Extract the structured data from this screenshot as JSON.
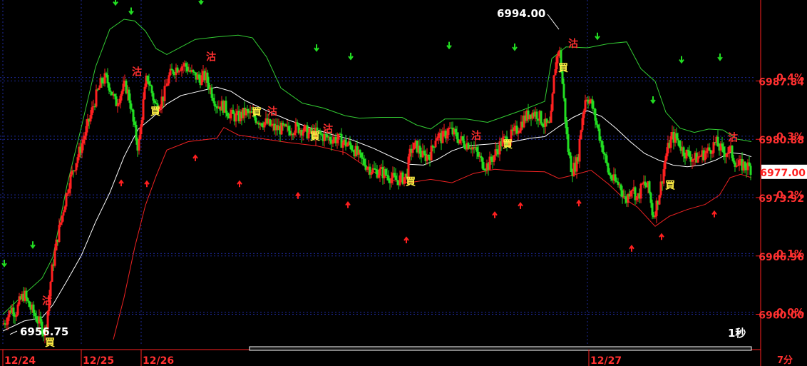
{
  "colors": {
    "background": "#000000",
    "up": "#ff2020",
    "down": "#22dd22",
    "ma": "#ffffff",
    "band_upper": "#33cc33",
    "band_lower": "#ee2222",
    "grid": "#1e2a9a",
    "label_red": "#ff3030",
    "signal": "#ffee44"
  },
  "chart_data": {
    "type": "candlestick",
    "x_ticks": [
      "12/24",
      "12/25",
      "12/26",
      "12/27"
    ],
    "timeframe": "7分",
    "period_label": "1秒",
    "last_price": "6977.00",
    "y_price_labels": [
      "6987.84",
      "6980.88",
      "6973.92",
      "6966.96",
      "6960.00"
    ],
    "y_pct_labels": [
      "0.4%",
      "0.3%",
      "0.2%",
      "0.1%",
      "0.0%"
    ],
    "ylim": [
      6956.3,
      6997.5
    ],
    "annotations": {
      "high": "6994.00",
      "low": "6956.75"
    },
    "signal_labels": {
      "buy": "買",
      "sell": "沽"
    },
    "close_path": [
      [
        0,
        6958.8
      ],
      [
        6,
        6959.6
      ],
      [
        12,
        6960.8
      ],
      [
        18,
        6960.2
      ],
      [
        24,
        6961.6
      ],
      [
        30,
        6962.4
      ],
      [
        36,
        6961.1
      ],
      [
        42,
        6960.3
      ],
      [
        48,
        6959.4
      ],
      [
        54,
        6958.6
      ],
      [
        58,
        6957.6
      ],
      [
        62,
        6959.6
      ],
      [
        68,
        6964.8
      ],
      [
        76,
        6968.9
      ],
      [
        84,
        6972.2
      ],
      [
        92,
        6975.5
      ],
      [
        100,
        6977.6
      ],
      [
        110,
        6980.1
      ],
      [
        120,
        6982.8
      ],
      [
        130,
        6985.8
      ],
      [
        138,
        6987.7
      ],
      [
        144,
        6988.2
      ],
      [
        150,
        6987.2
      ],
      [
        158,
        6985.1
      ],
      [
        166,
        6986.5
      ],
      [
        172,
        6987.3
      ],
      [
        178,
        6985.6
      ],
      [
        184,
        6982.3
      ],
      [
        190,
        6979.7
      ],
      [
        196,
        6984.6
      ],
      [
        202,
        6988.5
      ],
      [
        208,
        6986.8
      ],
      [
        214,
        6984.8
      ],
      [
        220,
        6985.3
      ],
      [
        226,
        6986.1
      ],
      [
        232,
        6988.2
      ],
      [
        240,
        6989.2
      ],
      [
        248,
        6989.7
      ],
      [
        256,
        6989.7
      ],
      [
        266,
        6988.6
      ],
      [
        276,
        6988.1
      ],
      [
        284,
        6988.4
      ],
      [
        292,
        6986.7
      ],
      [
        300,
        6985.0
      ],
      [
        310,
        6984.8
      ],
      [
        320,
        6983.7
      ],
      [
        330,
        6983.5
      ],
      [
        340,
        6984.1
      ],
      [
        350,
        6983.7
      ],
      [
        360,
        6983.1
      ],
      [
        370,
        6982.8
      ],
      [
        380,
        6982.2
      ],
      [
        390,
        6982.1
      ],
      [
        400,
        6981.9
      ],
      [
        410,
        6982.3
      ],
      [
        420,
        6982.1
      ],
      [
        430,
        6981.5
      ],
      [
        440,
        6981.6
      ],
      [
        450,
        6981.2
      ],
      [
        460,
        6981.0
      ],
      [
        470,
        6980.9
      ],
      [
        480,
        6980.4
      ],
      [
        490,
        6980.0
      ],
      [
        500,
        6978.7
      ],
      [
        510,
        6977.8
      ],
      [
        520,
        6977.1
      ],
      [
        530,
        6977.0
      ],
      [
        540,
        6976.6
      ],
      [
        550,
        6976.0
      ],
      [
        560,
        6976.2
      ],
      [
        566,
        6976.5
      ],
      [
        572,
        6979.6
      ],
      [
        580,
        6980.1
      ],
      [
        590,
        6978.7
      ],
      [
        600,
        6979.2
      ],
      [
        608,
        6981.4
      ],
      [
        616,
        6981.0
      ],
      [
        626,
        6982.1
      ],
      [
        636,
        6981.2
      ],
      [
        646,
        6980.5
      ],
      [
        656,
        6980.3
      ],
      [
        664,
        6979.3
      ],
      [
        672,
        6978.1
      ],
      [
        680,
        6977.7
      ],
      [
        690,
        6979.1
      ],
      [
        700,
        6980.6
      ],
      [
        710,
        6981.0
      ],
      [
        720,
        6981.9
      ],
      [
        730,
        6983.2
      ],
      [
        740,
        6984.1
      ],
      [
        750,
        6983.9
      ],
      [
        760,
        6982.6
      ],
      [
        768,
        6982.4
      ],
      [
        774,
        6989.2
      ],
      [
        780,
        6992.1
      ],
      [
        786,
        6986.6
      ],
      [
        792,
        6980.1
      ],
      [
        798,
        6977.1
      ],
      [
        806,
        6978.2
      ],
      [
        812,
        6983.1
      ],
      [
        818,
        6986.2
      ],
      [
        826,
        6985.0
      ],
      [
        834,
        6982.3
      ],
      [
        842,
        6979.6
      ],
      [
        850,
        6976.7
      ],
      [
        858,
        6975.8
      ],
      [
        866,
        6975.4
      ],
      [
        874,
        6973.4
      ],
      [
        882,
        6975.5
      ],
      [
        890,
        6973.7
      ],
      [
        898,
        6975.6
      ],
      [
        906,
        6975.0
      ],
      [
        912,
        6971.6
      ],
      [
        918,
        6973.4
      ],
      [
        924,
        6975.8
      ],
      [
        930,
        6978.9
      ],
      [
        938,
        6981.2
      ],
      [
        946,
        6980.9
      ],
      [
        954,
        6979.5
      ],
      [
        962,
        6979.0
      ],
      [
        970,
        6978.5
      ],
      [
        980,
        6979.0
      ],
      [
        990,
        6979.5
      ],
      [
        1000,
        6980.5
      ],
      [
        1010,
        6979.3
      ],
      [
        1020,
        6979.6
      ],
      [
        1030,
        6977.7
      ],
      [
        1040,
        6977.8
      ],
      [
        1050,
        6977.4
      ]
    ],
    "upper_band": [
      [
        0,
        6960.0
      ],
      [
        30,
        6962.4
      ],
      [
        55,
        6964.3
      ],
      [
        70,
        6966.8
      ],
      [
        90,
        6975.4
      ],
      [
        110,
        6982.3
      ],
      [
        130,
        6989.5
      ],
      [
        150,
        6994.0
      ],
      [
        170,
        6995.2
      ],
      [
        185,
        6995.0
      ],
      [
        200,
        6993.8
      ],
      [
        215,
        6991.7
      ],
      [
        230,
        6991.0
      ],
      [
        250,
        6991.9
      ],
      [
        270,
        6992.8
      ],
      [
        300,
        6993.1
      ],
      [
        330,
        6993.3
      ],
      [
        350,
        6993.0
      ],
      [
        370,
        6990.7
      ],
      [
        390,
        6987.0
      ],
      [
        420,
        6985.2
      ],
      [
        450,
        6984.6
      ],
      [
        480,
        6983.7
      ],
      [
        500,
        6983.4
      ],
      [
        530,
        6983.5
      ],
      [
        560,
        6983.5
      ],
      [
        580,
        6982.6
      ],
      [
        600,
        6982.1
      ],
      [
        620,
        6983.3
      ],
      [
        650,
        6983.3
      ],
      [
        680,
        6982.9
      ],
      [
        700,
        6983.5
      ],
      [
        730,
        6984.4
      ],
      [
        760,
        6985.4
      ],
      [
        770,
        6990.5
      ],
      [
        790,
        6991.9
      ],
      [
        820,
        6991.8
      ],
      [
        850,
        6992.3
      ],
      [
        875,
        6992.5
      ],
      [
        895,
        6989.3
      ],
      [
        915,
        6987.8
      ],
      [
        930,
        6984.1
      ],
      [
        950,
        6982.2
      ],
      [
        970,
        6981.7
      ],
      [
        990,
        6982.1
      ],
      [
        1010,
        6982.0
      ],
      [
        1030,
        6980.9
      ],
      [
        1050,
        6980.6
      ]
    ],
    "ma_line": [
      [
        0,
        6958.0
      ],
      [
        30,
        6959.2
      ],
      [
        55,
        6959.6
      ],
      [
        70,
        6961.1
      ],
      [
        90,
        6964.0
      ],
      [
        110,
        6967.0
      ],
      [
        130,
        6971.0
      ],
      [
        150,
        6974.5
      ],
      [
        170,
        6978.8
      ],
      [
        190,
        6982.1
      ],
      [
        210,
        6983.5
      ],
      [
        230,
        6985.1
      ],
      [
        250,
        6986.1
      ],
      [
        270,
        6986.5
      ],
      [
        300,
        6987.1
      ],
      [
        320,
        6986.6
      ],
      [
        340,
        6985.5
      ],
      [
        370,
        6984.3
      ],
      [
        400,
        6983.2
      ],
      [
        430,
        6982.3
      ],
      [
        460,
        6981.5
      ],
      [
        490,
        6980.8
      ],
      [
        520,
        6979.8
      ],
      [
        550,
        6978.6
      ],
      [
        570,
        6977.9
      ],
      [
        590,
        6977.8
      ],
      [
        610,
        6978.5
      ],
      [
        630,
        6979.5
      ],
      [
        650,
        6980.1
      ],
      [
        680,
        6980.3
      ],
      [
        710,
        6980.5
      ],
      [
        740,
        6981.0
      ],
      [
        760,
        6981.2
      ],
      [
        780,
        6982.4
      ],
      [
        800,
        6983.5
      ],
      [
        820,
        6984.3
      ],
      [
        840,
        6983.6
      ],
      [
        860,
        6982.2
      ],
      [
        880,
        6980.6
      ],
      [
        900,
        6979.2
      ],
      [
        920,
        6978.4
      ],
      [
        940,
        6977.8
      ],
      [
        960,
        6977.6
      ],
      [
        980,
        6977.8
      ],
      [
        1000,
        6978.4
      ],
      [
        1020,
        6979.3
      ],
      [
        1040,
        6979.1
      ],
      [
        1050,
        6978.8
      ]
    ],
    "lower_band": [
      [
        155,
        6957.0
      ],
      [
        170,
        6962.0
      ],
      [
        185,
        6968.0
      ],
      [
        200,
        6973.0
      ],
      [
        215,
        6976.5
      ],
      [
        230,
        6979.6
      ],
      [
        260,
        6980.6
      ],
      [
        300,
        6981.0
      ],
      [
        310,
        6982.3
      ],
      [
        330,
        6981.4
      ],
      [
        360,
        6981.0
      ],
      [
        400,
        6980.5
      ],
      [
        440,
        6980.1
      ],
      [
        480,
        6979.3
      ],
      [
        520,
        6977.0
      ],
      [
        550,
        6975.9
      ],
      [
        570,
        6975.7
      ],
      [
        600,
        6976.1
      ],
      [
        630,
        6975.7
      ],
      [
        660,
        6976.8
      ],
      [
        690,
        6977.3
      ],
      [
        720,
        6977.1
      ],
      [
        760,
        6977.0
      ],
      [
        780,
        6976.2
      ],
      [
        800,
        6976.6
      ],
      [
        825,
        6977.2
      ],
      [
        850,
        6975.5
      ],
      [
        870,
        6973.9
      ],
      [
        890,
        6972.8
      ],
      [
        915,
        6970.5
      ],
      [
        935,
        6971.7
      ],
      [
        960,
        6972.5
      ],
      [
        985,
        6973.1
      ],
      [
        1005,
        6974.2
      ],
      [
        1020,
        6976.3
      ],
      [
        1035,
        6976.7
      ],
      [
        1050,
        6976.3
      ]
    ],
    "arrows_down": [
      [
        2,
        6966.0
      ],
      [
        42,
        6968.2
      ],
      [
        158,
        6997.2
      ],
      [
        180,
        6996.1
      ],
      [
        278,
        6997.3
      ],
      [
        440,
        6991.7
      ],
      [
        488,
        6990.7
      ],
      [
        626,
        6992.0
      ],
      [
        718,
        6991.8
      ],
      [
        834,
        6993.1
      ],
      [
        912,
        6985.5
      ],
      [
        952,
        6990.3
      ],
      [
        1006,
        6990.6
      ]
    ],
    "arrows_up": [
      [
        166,
        6975.7
      ],
      [
        202,
        6975.6
      ],
      [
        270,
        6978.7
      ],
      [
        332,
        6975.6
      ],
      [
        414,
        6974.2
      ],
      [
        484,
        6973.1
      ],
      [
        566,
        6968.9
      ],
      [
        690,
        6971.9
      ],
      [
        726,
        6973.0
      ],
      [
        808,
        6973.3
      ],
      [
        882,
        6967.9
      ],
      [
        924,
        6969.3
      ],
      [
        998,
        6972.0
      ]
    ],
    "signals": [
      [
        "sell",
        62,
        6961.2
      ],
      [
        "buy",
        66,
        6956.2
      ],
      [
        "sell",
        188,
        6988.5
      ],
      [
        "buy",
        214,
        6983.8
      ],
      [
        "sell",
        292,
        6990.3
      ],
      [
        "buy",
        356,
        6983.7
      ],
      [
        "sell",
        378,
        6983.8
      ],
      [
        "buy",
        438,
        6980.8
      ],
      [
        "sell",
        456,
        6981.7
      ],
      [
        "buy",
        572,
        6975.4
      ],
      [
        "sell",
        664,
        6980.9
      ],
      [
        "buy",
        708,
        6979.9
      ],
      [
        "sell",
        800,
        6991.9
      ],
      [
        "buy",
        786,
        6989.0
      ],
      [
        "buy",
        936,
        6975.0
      ],
      [
        "sell",
        1024,
        6980.7
      ]
    ]
  }
}
